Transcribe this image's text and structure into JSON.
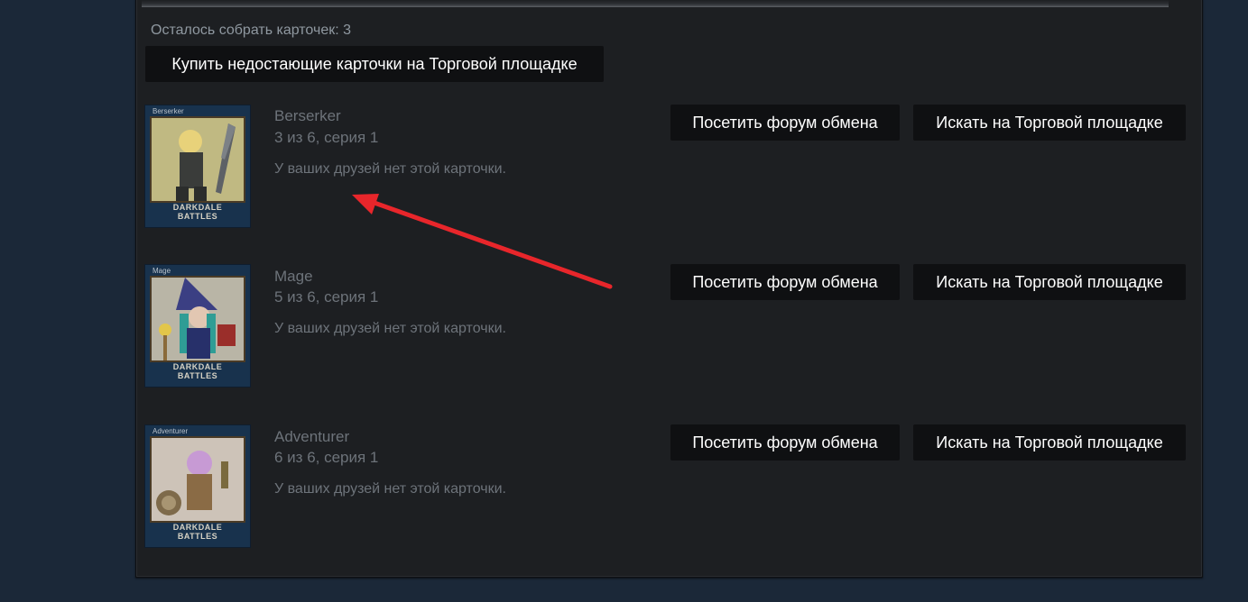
{
  "header": {
    "remaining": "Осталось собрать карточек: 3",
    "buy_button": "Купить недостающие карточки на Торговой площадке"
  },
  "cards": [
    {
      "caption": "Berserker",
      "name": "Berserker",
      "series": "3 из 6, серия 1",
      "note": "У ваших друзей нет этой карточки.",
      "logo": "DARKDALE BATTLES",
      "forum_button": "Посетить форум обмена",
      "market_button": "Искать на Торговой площадке"
    },
    {
      "caption": "Mage",
      "name": "Mage",
      "series": "5 из 6, серия 1",
      "note": "У ваших друзей нет этой карточки.",
      "logo": "DARKDALE BATTLES",
      "forum_button": "Посетить форум обмена",
      "market_button": "Искать на Торговой площадке"
    },
    {
      "caption": "Adventurer",
      "name": "Adventurer",
      "series": "6 из 6, серия 1",
      "note": "У ваших друзей нет этой карточки.",
      "logo": "DARKDALE BATTLES",
      "forum_button": "Посетить форум обмена",
      "market_button": "Искать на Торговой площадке"
    }
  ],
  "annotation": {
    "arrow_color": "#e8262b"
  },
  "colors": {
    "page_bg": "#1b2838",
    "panel_bg": "#1d1f22",
    "button_bg": "#0f1012"
  }
}
